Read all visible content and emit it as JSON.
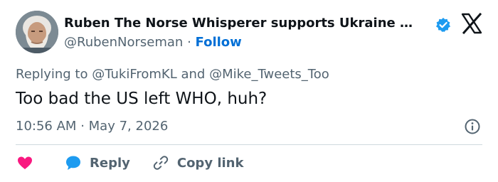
{
  "author": {
    "display_name": "Ruben The Norse Whisperer supports Ukraine …",
    "handle": "@RubenNorseman",
    "separator": "·",
    "follow_label": "Follow"
  },
  "tweet": {
    "reply_prefix": "Replying to",
    "mentions": [
      "@TukiFromKL",
      "@Mike_Tweets_Too"
    ],
    "mention_joiner": "and",
    "text": "Too bad the US left WHO, huh?",
    "time": "10:56 AM",
    "date_separator": "·",
    "date": "May 7, 2026"
  },
  "actions": {
    "reply_label": "Reply",
    "copy_link_label": "Copy link"
  },
  "icons": {
    "verified": "verified-badge-icon",
    "logo": "x-logo-icon",
    "info": "info-icon",
    "like": "heart-icon",
    "reply": "speech-bubble-icon",
    "copy": "link-icon"
  },
  "colors": {
    "accent": "#006fd6",
    "verified": "#1d9bf0",
    "like": "#f91880",
    "text": "#0f1419",
    "secondary": "#536471"
  }
}
